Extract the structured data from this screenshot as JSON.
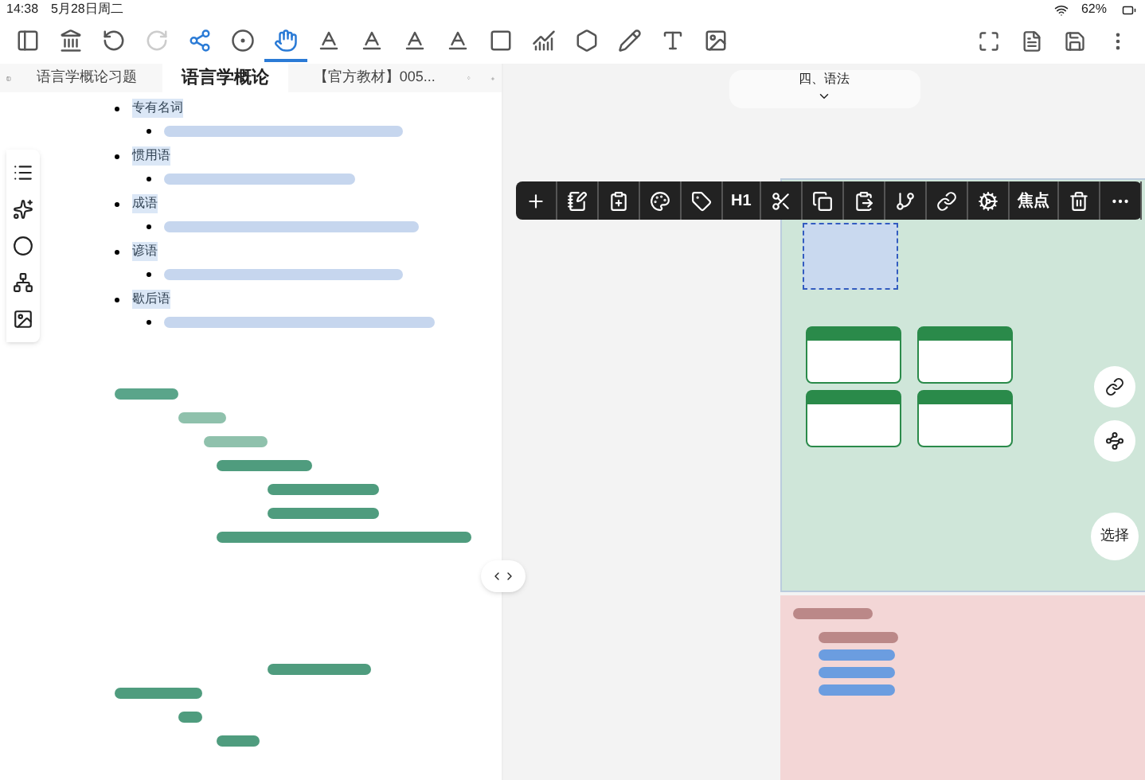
{
  "status_bar": {
    "time": "14:38",
    "date": "5月28日周二",
    "battery": "62%"
  },
  "toolbar": {
    "items": [
      {
        "kind": "sidebar",
        "selected": false,
        "disabled": false
      },
      {
        "kind": "library",
        "selected": false,
        "disabled": false
      },
      {
        "kind": "undo",
        "selected": false,
        "disabled": false
      },
      {
        "kind": "redo",
        "selected": false,
        "disabled": true
      },
      {
        "kind": "mindmap",
        "selected": false,
        "disabled": false
      },
      {
        "kind": "target",
        "selected": false,
        "disabled": false
      },
      {
        "kind": "hand",
        "selected": true,
        "disabled": false
      },
      {
        "kind": "letter",
        "selected": false,
        "disabled": false
      },
      {
        "kind": "letter",
        "selected": false,
        "disabled": false
      },
      {
        "kind": "letter",
        "selected": false,
        "disabled": false
      },
      {
        "kind": "letter",
        "selected": false,
        "disabled": false
      },
      {
        "kind": "square",
        "selected": false,
        "disabled": false
      },
      {
        "kind": "chart",
        "selected": false,
        "disabled": false
      },
      {
        "kind": "shape",
        "selected": false,
        "disabled": false
      },
      {
        "kind": "pen",
        "selected": false,
        "disabled": false
      },
      {
        "kind": "textbox",
        "selected": false,
        "disabled": false
      },
      {
        "kind": "image",
        "selected": false,
        "disabled": false
      }
    ],
    "right_items": [
      {
        "kind": "expand"
      },
      {
        "kind": "document"
      },
      {
        "kind": "save"
      },
      {
        "kind": "more"
      }
    ]
  },
  "tabs": [
    {
      "label": "语言学概论习题",
      "selected": false
    },
    {
      "label": "语言学概论",
      "selected": true
    },
    {
      "label": "【官方教材】005...",
      "selected": false
    }
  ],
  "outline": [
    {
      "label": "专有名词"
    },
    {
      "label": "惯用语"
    },
    {
      "label": "成语"
    },
    {
      "label": "谚语"
    },
    {
      "label": "歇后语"
    }
  ],
  "canvas": {
    "root_node": {
      "label": "四、语法"
    },
    "node_toolbar": [
      {
        "kind": "add"
      },
      {
        "kind": "note"
      },
      {
        "kind": "clipboard"
      },
      {
        "kind": "palette"
      },
      {
        "kind": "tag"
      },
      {
        "kind": "text",
        "label": "H1"
      },
      {
        "kind": "cut"
      },
      {
        "kind": "copy"
      },
      {
        "kind": "paste"
      },
      {
        "kind": "branch"
      },
      {
        "kind": "link"
      },
      {
        "kind": "settings"
      },
      {
        "kind": "text",
        "label": "焦点"
      },
      {
        "kind": "delete"
      },
      {
        "kind": "more"
      }
    ],
    "select_button": {
      "label": "选择"
    }
  }
}
